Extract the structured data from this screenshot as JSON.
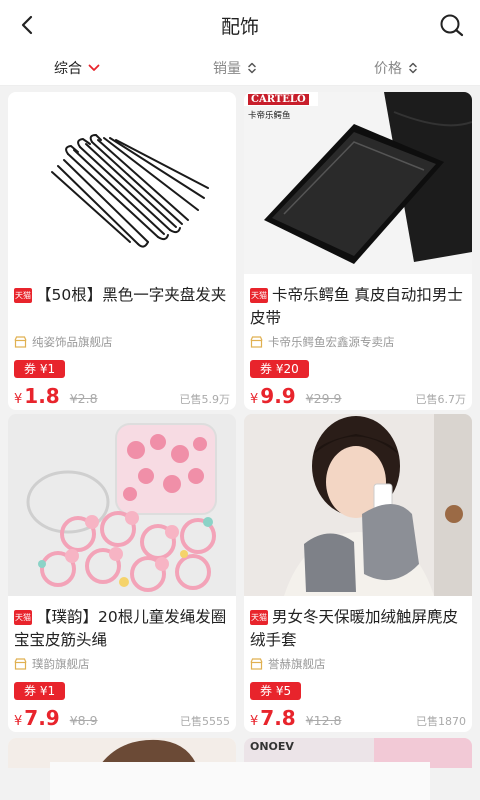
{
  "header": {
    "title": "配饰"
  },
  "sort_tabs": [
    {
      "label": "综合"
    },
    {
      "label": "销量"
    },
    {
      "label": "价格"
    }
  ],
  "colors": {
    "accent": "#e8242c"
  },
  "products": [
    {
      "title": "【50根】黑色一字夹盘发夹",
      "shop": "纯姿饰品旗舰店",
      "coupon": "券 ¥1",
      "currency": "¥",
      "price": "1.8",
      "original_price": "¥2.8",
      "sold": "已售5.9万",
      "tmall_badge": "天猫"
    },
    {
      "title": "卡帝乐鳄鱼 真皮自动扣男士皮带",
      "shop": "卡帝乐鳄鱼宏鑫源专卖店",
      "coupon": "券 ¥20",
      "currency": "¥",
      "price": "9.9",
      "original_price": "¥29.9",
      "sold": "已售6.7万",
      "tmall_badge": "天猫",
      "image_text": {
        "brand": "CARTELO",
        "brand_cn": "卡帝乐鳄鱼"
      }
    },
    {
      "title": "【璞韵】20根儿童发绳发圈宝宝皮筋头绳",
      "shop": "璞韵旗舰店",
      "coupon": "券 ¥1",
      "currency": "¥",
      "price": "7.9",
      "original_price": "¥8.9",
      "sold": "已售5555",
      "tmall_badge": "天猫"
    },
    {
      "title": "男女冬天保暖加绒触屏麂皮绒手套",
      "shop": "誉赫旗舰店",
      "coupon": "券 ¥5",
      "currency": "¥",
      "price": "7.8",
      "original_price": "¥12.8",
      "sold": "已售1870",
      "tmall_badge": "天猫"
    }
  ],
  "peek": {
    "right_brand": "ONOEV"
  }
}
